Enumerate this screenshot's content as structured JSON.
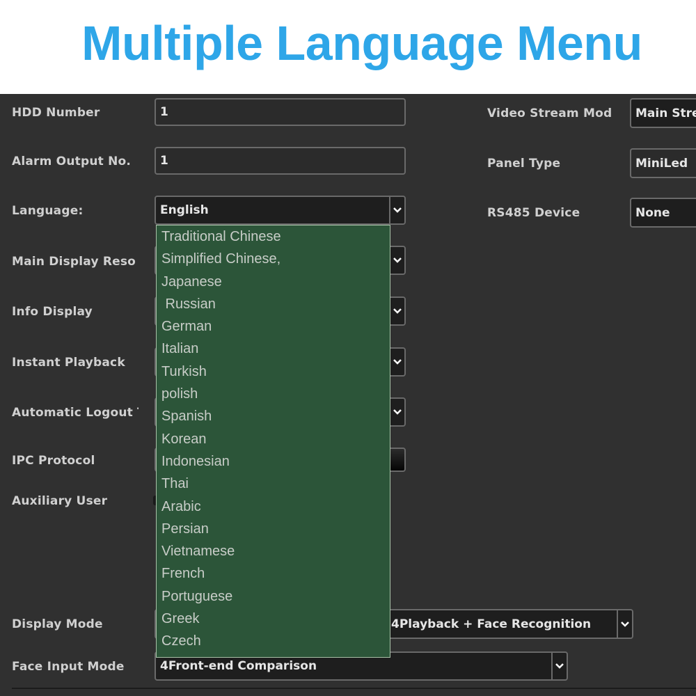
{
  "banner": {
    "title": "Multiple Language Menu",
    "title_color": "#2ea6e8"
  },
  "form": {
    "hdd_number": {
      "label": "HDD Number",
      "value": "1"
    },
    "alarm_output": {
      "label": "Alarm Output No.",
      "value": "1"
    },
    "language": {
      "label": "Language:",
      "value": "English"
    },
    "main_display": {
      "label": "Main Display Reso"
    },
    "info_display": {
      "label": "Info Display"
    },
    "instant_playback": {
      "label": "Instant Playback"
    },
    "auto_logout": {
      "label": "Automatic Logout T"
    },
    "ipc_protocol": {
      "label": "IPC Protocol"
    },
    "auxiliary_user": {
      "label": "Auxiliary User"
    },
    "display_mode": {
      "label": "Display Mode",
      "value": "4Playback + Face Recognition"
    },
    "face_input_mode": {
      "label": "Face Input Mode",
      "value": "4Front-end Comparison"
    },
    "video_stream_mode": {
      "label": "Video Stream Mode",
      "value": "Main Stream"
    },
    "panel_type": {
      "label": "Panel Type",
      "value": "MiniLed"
    },
    "rs485_device": {
      "label": "RS485 Device",
      "value": "None"
    }
  },
  "language_options": [
    "Traditional Chinese",
    "Simplified Chinese,",
    "Japanese",
    " Russian",
    "German",
    "Italian",
    "Turkish",
    "polish",
    "Spanish",
    "Korean",
    "Indonesian",
    "Thai",
    "Arabic",
    "Persian",
    "Vietnamese",
    "French",
    "Portuguese",
    "Greek",
    "Czech"
  ],
  "colors": {
    "dropdown_bg": "#2c5539",
    "panel_bg": "#303030"
  }
}
